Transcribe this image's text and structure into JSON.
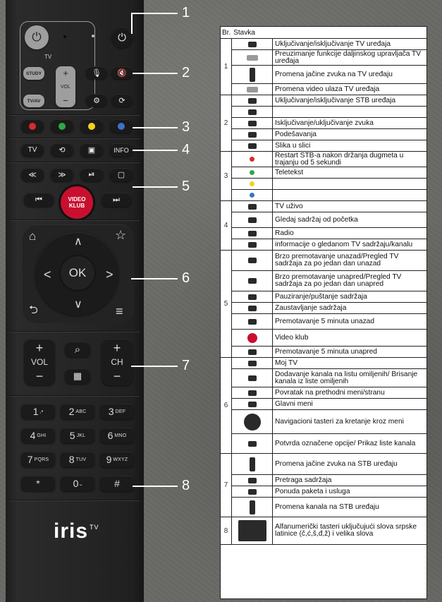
{
  "remote": {
    "tv_label": "TV",
    "study_label": "STUDY",
    "tvav_label": "TV/AV",
    "vol_label": "VOL",
    "tv_key": "TV",
    "info_key": "INFO",
    "video_klub_line1": "VIDEO",
    "video_klub_line2": "KLUB",
    "ok_label": "OK",
    "vol_rocker": "VOL",
    "ch_rocker": "CH",
    "keys": [
      {
        "num": "1",
        "sub": ",•"
      },
      {
        "num": "2",
        "sub": "ABC"
      },
      {
        "num": "3",
        "sub": "DEF"
      },
      {
        "num": "4",
        "sub": "GHI"
      },
      {
        "num": "5",
        "sub": "JKL"
      },
      {
        "num": "6",
        "sub": "MNO"
      },
      {
        "num": "7",
        "sub": "PQRS"
      },
      {
        "num": "8",
        "sub": "TUV"
      },
      {
        "num": "9",
        "sub": "WXYZ"
      },
      {
        "num": "*",
        "sub": ""
      },
      {
        "num": "0",
        "sub": "⎵"
      },
      {
        "num": "#",
        "sub": ""
      }
    ],
    "logo": "iris",
    "logo_sup": "TV",
    "colors": {
      "red": "#d92b2b",
      "green": "#2ea84a",
      "yellow": "#f2d21b",
      "blue": "#3b73c8"
    }
  },
  "callouts": [
    "1",
    "2",
    "3",
    "4",
    "5",
    "6",
    "7",
    "8"
  ],
  "table": {
    "header": {
      "col1": "Br.",
      "col2": "Stavka"
    },
    "groups": [
      {
        "label": "1",
        "rows": [
          {
            "icon": "power-icon",
            "glyph": "⏻",
            "text": "Uključivanje/isključivanje TV uređaja"
          },
          {
            "icon": "study-icon",
            "glyph": "STUDY",
            "text": "Preuzimanje funkcije daljinskog upravljača TV uređaja"
          },
          {
            "icon": "tv-vol-icon",
            "glyph": "VOL",
            "text": "Promena jačine zvuka na TV uređaju"
          },
          {
            "icon": "tvav-icon",
            "glyph": "TV/AV",
            "text": "Promena video ulaza TV uređaja"
          }
        ]
      },
      {
        "label": "2",
        "rows": [
          {
            "icon": "power-icon",
            "glyph": "⏻",
            "text": "Uključivanje/isključivanje STB uređaja"
          },
          {
            "icon": "microphone-icon",
            "glyph": "🎙",
            "text": ""
          },
          {
            "icon": "mute-icon",
            "glyph": "🔇",
            "text": "Isključivanje/uključivanje zvuka"
          },
          {
            "icon": "gear-icon",
            "glyph": "⚙",
            "text": "Podešavanja"
          },
          {
            "icon": "pip-icon",
            "glyph": "⟳",
            "text": "Slika u slici"
          }
        ]
      },
      {
        "label": "3",
        "rows": [
          {
            "icon": "red-dot-icon",
            "glyph": "●",
            "text": "Restart STB-a nakon držanja dugmeta u trajanju od 5 sekundi"
          },
          {
            "icon": "green-dot-icon",
            "glyph": "●",
            "text": "Teletekst"
          },
          {
            "icon": "yellow-dot-icon",
            "glyph": "●",
            "text": ""
          },
          {
            "icon": "blue-dot-icon",
            "glyph": "●",
            "text": ""
          }
        ]
      },
      {
        "label": "4",
        "rows": [
          {
            "icon": "tv-icon",
            "glyph": "TV",
            "text": "TV uživo"
          },
          {
            "icon": "restart-tv-icon",
            "glyph": "⟲",
            "text": "Gledaj sadržaj od početka"
          },
          {
            "icon": "radio-icon",
            "glyph": "▣",
            "text": "Radio"
          },
          {
            "icon": "info-icon",
            "glyph": "INFO",
            "text": "informacije o gledanom TV sadržaju/kanalu"
          }
        ]
      },
      {
        "label": "5",
        "rows": [
          {
            "icon": "rewind-icon",
            "glyph": "≪",
            "text": "Brzo premotavanje unazad/Pregled TV sadržaja za po jedan dan unazad"
          },
          {
            "icon": "fast-forward-icon",
            "glyph": "≫",
            "text": "Brzo premotavanje unapred/Pregled TV sadržaja za po jedan dan unapred"
          },
          {
            "icon": "play-pause-icon",
            "glyph": "⏯",
            "text": "Pauziranje/puštanje sadržaja"
          },
          {
            "icon": "stop-icon",
            "glyph": "▢",
            "text": "Zaustavljanje sadržaja"
          },
          {
            "icon": "skip-back-icon",
            "glyph": "⏮",
            "text": "Premotavanje 5 minuta unazad"
          },
          {
            "icon": "video-klub-icon",
            "glyph": "VK",
            "text": "Video klub"
          },
          {
            "icon": "skip-forward-icon",
            "glyph": "⏭",
            "text": "Premotavanje 5 minuta unapred"
          }
        ]
      },
      {
        "label": "6",
        "rows": [
          {
            "icon": "home-icon",
            "glyph": "⌂",
            "text": "Moj TV"
          },
          {
            "icon": "star-icon",
            "glyph": "☆",
            "text": "Dodavanje kanala na listu omiljenih/ Brisanje kanala iz liste omiljenih"
          },
          {
            "icon": "back-icon",
            "glyph": "⮌",
            "text": "Povratak na prethodni meni/stranu"
          },
          {
            "icon": "menu-icon",
            "glyph": "≡",
            "text": "Glavni meni"
          },
          {
            "icon": "nav-pad-icon",
            "glyph": "✥",
            "text": "Navigacioni tasteri za kretanje kroz meni"
          },
          {
            "icon": "ok-icon",
            "glyph": "OK",
            "text": "Potvrda označene opcije/ Prikaz liste kanala"
          }
        ]
      },
      {
        "label": "7",
        "rows": [
          {
            "icon": "stb-vol-icon",
            "glyph": "VOL",
            "text": "Promena jačine zvuka na STB uređaju"
          },
          {
            "icon": "search-icon",
            "glyph": "⌕",
            "text": "Pretraga sadržaja"
          },
          {
            "icon": "shop-icon",
            "glyph": "▦",
            "text": "Ponuda paketa i usluga"
          },
          {
            "icon": "channel-icon",
            "glyph": "CH",
            "text": "Promena kanala na STB uređaju"
          }
        ]
      },
      {
        "label": "8",
        "rows": [
          {
            "icon": "keypad-icon",
            "glyph": "123",
            "text": "Alfanumerički tasteri uključujući slova srpske latinice (č,ć,š,đ,ž) i velika slova"
          }
        ]
      }
    ]
  }
}
